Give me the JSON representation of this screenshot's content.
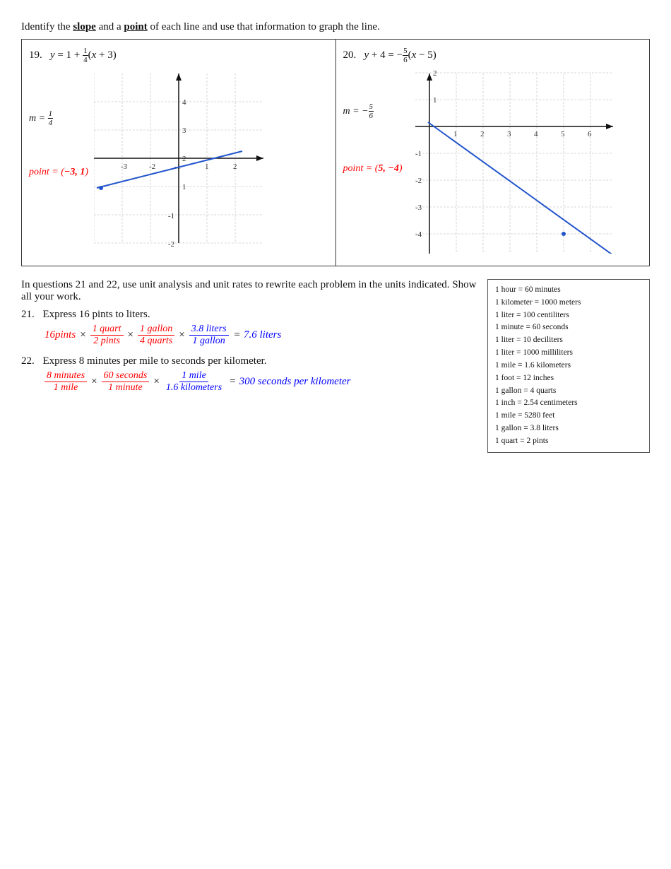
{
  "instruction": {
    "text": "Identify the slope and a point of each line and use that information to graph the line."
  },
  "problem19": {
    "number": "19.",
    "equation": "y = 1 + ¼(x + 3)",
    "slope_label": "m =",
    "slope_value": "1/4",
    "point_label": "point =",
    "point_value": "(−3, 1)"
  },
  "problem20": {
    "number": "20.",
    "equation": "y + 4 = −⁵⁄₆(x − 5)",
    "slope_label": "m =",
    "slope_value": "−5/6",
    "point_label": "point =",
    "point_value": "(5, −4)"
  },
  "section_intro": "In questions 21 and 22, use unit analysis and unit rates to rewrite each problem in the units indicated. Show all your work.",
  "problem21": {
    "number": "21.",
    "text": "Express 16 pints to liters.",
    "equation_parts": [
      "16 pints",
      "×",
      "1 quart / 2 pints",
      "×",
      "1 gallon / 4 quarts",
      "×",
      "3.8 liters / 1 gallon",
      "=",
      "7.6 liters"
    ]
  },
  "problem22": {
    "number": "22.",
    "text": "Express 8 minutes per mile to seconds per kilometer.",
    "equation_parts": [
      "8 minutes / 1 mile",
      "×",
      "60 seconds / 1 minute",
      "×",
      "1 mile / 1.6 kilometers",
      "=",
      "300 seconds per kilometer"
    ]
  },
  "unit_box": {
    "title": "",
    "conversions": [
      "1 hour = 60 minutes",
      "1 kilometer = 1000 meters",
      "1 liter = 100 centiliters",
      "1 minute = 60 seconds",
      "1 liter = 10 deciliters",
      "1 liter = 1000 milliliters",
      "1 mile = 1.6 kilometers",
      "1 foot = 12 inches",
      "1 gallon = 4 quarts",
      "1 inch = 2.54 centimeters",
      "1 mile = 5280 feet",
      "1 gallon = 3.8 liters",
      "1 quart = 2 pints"
    ]
  }
}
